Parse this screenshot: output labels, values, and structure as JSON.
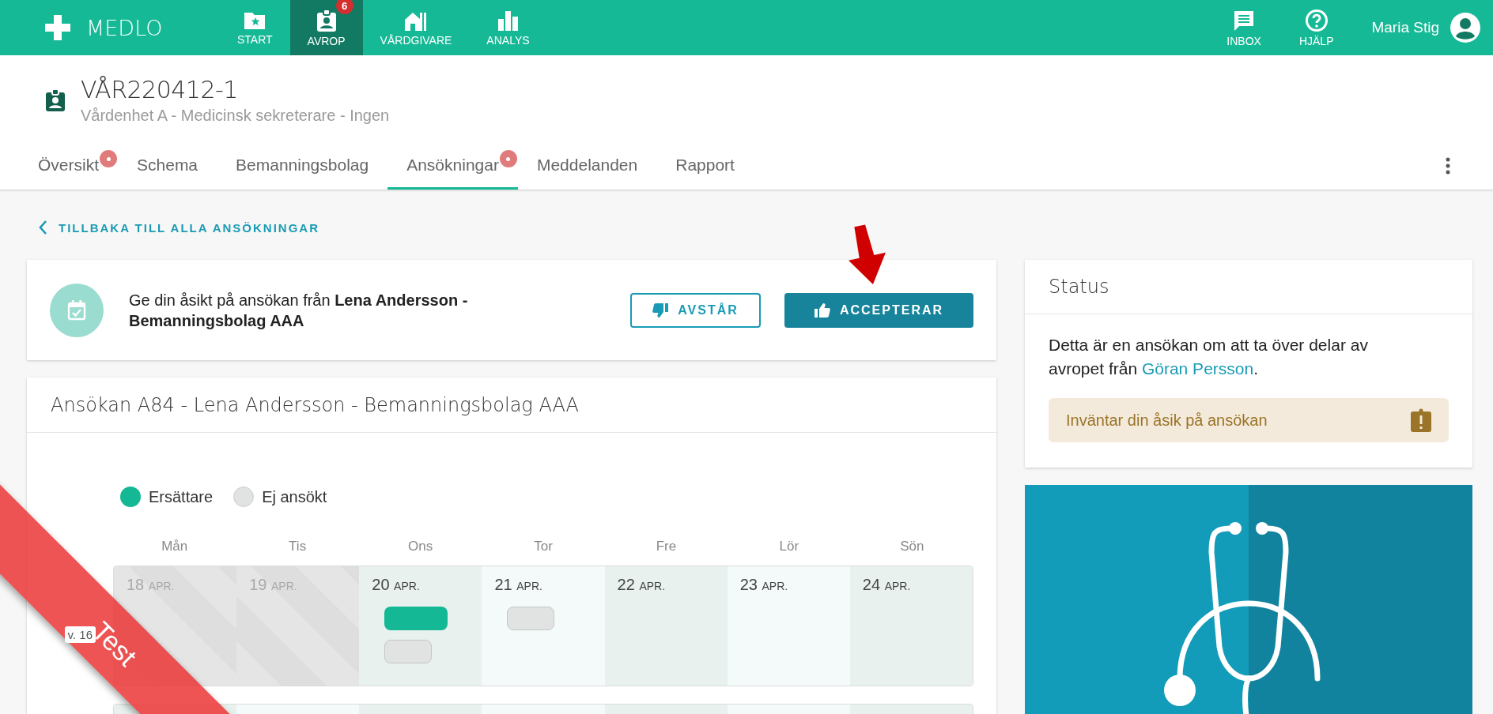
{
  "topbar": {
    "brand": "MEDLO",
    "nav": [
      {
        "label": "START",
        "selected": false
      },
      {
        "label": "AVROP",
        "selected": true,
        "badge": "6"
      },
      {
        "label": "VÅRDGIVARE",
        "selected": false
      },
      {
        "label": "ANALYS",
        "selected": false
      }
    ],
    "actions": [
      {
        "label": "INBOX"
      },
      {
        "label": "HJÄLP"
      }
    ],
    "user": "Maria Stig"
  },
  "header": {
    "title": "VÅR220412-1",
    "subtitle": "Vårdenhet A - Medicinsk sekreterare - Ingen",
    "tabs": [
      {
        "label": "Översikt",
        "selected": false,
        "notification": true
      },
      {
        "label": "Schema",
        "selected": false,
        "notification": false
      },
      {
        "label": "Bemanningsbolag",
        "selected": false,
        "notification": false
      },
      {
        "label": "Ansökningar",
        "selected": true,
        "notification": true
      },
      {
        "label": "Meddelanden",
        "selected": false,
        "notification": false
      },
      {
        "label": "Rapport",
        "selected": false,
        "notification": false
      }
    ]
  },
  "back_link": "TILLBAKA TILL ALLA ANSÖKNINGAR",
  "decision": {
    "text": "Ge din åsikt på ansökan från **Lena Andersson - Bemanningsbolag AAA**",
    "buttons": [
      {
        "label": "AVSTÅR",
        "kind": "outline"
      },
      {
        "label": "ACCEPTERAR",
        "kind": "primary"
      }
    ]
  },
  "application": {
    "title": "Ansökan A84 - Lena Andersson - Bemanningsbolag AAA",
    "legend": [
      {
        "label": "Ersättare",
        "kind": "substitute",
        "color": "#14b894"
      },
      {
        "label": "Ej ansökt",
        "kind": "not_applied",
        "color": "#e1e2e2"
      }
    ],
    "weekdays": [
      "Mån",
      "Tis",
      "Ons",
      "Tor",
      "Fre",
      "Lör",
      "Sön"
    ],
    "weeks": [
      {
        "label": "v. 16",
        "days": [
          {
            "day": "18",
            "month": "APR.",
            "past": true
          },
          {
            "day": "19",
            "month": "APR.",
            "past": true
          },
          {
            "day": "20",
            "month": "APR.",
            "past": false,
            "shifts": [
              {
                "kind": "substitute"
              },
              {
                "kind": "not_applied"
              }
            ]
          },
          {
            "day": "21",
            "month": "APR.",
            "past": false,
            "shifts": [
              {
                "kind": "not_applied"
              }
            ]
          },
          {
            "day": "22",
            "month": "APR.",
            "past": false
          },
          {
            "day": "23",
            "month": "APR.",
            "past": false
          },
          {
            "day": "24",
            "month": "APR.",
            "past": false
          }
        ]
      }
    ]
  },
  "status": {
    "title": "Status",
    "text_before": "Detta är en ansökan om att ta över delar av avropet från",
    "link": "Göran Persson",
    "text_after": ".",
    "alert": "Inväntar din åsik på ansökan"
  },
  "environment_ribbon": "Test"
}
